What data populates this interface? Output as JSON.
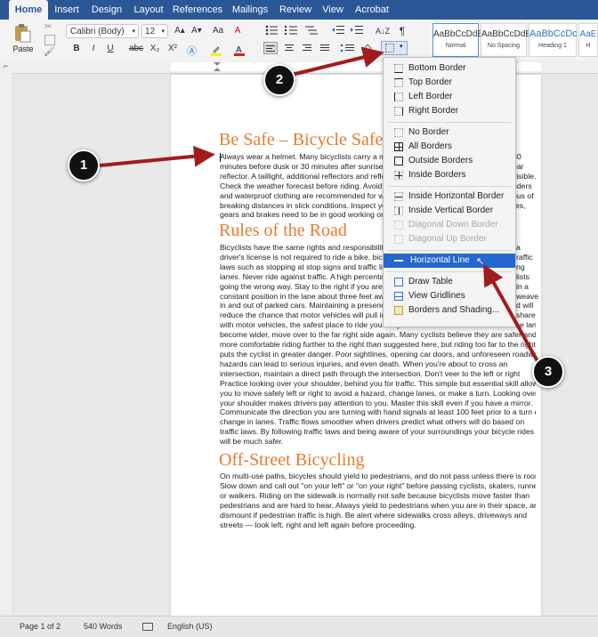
{
  "tabs": [
    "Home",
    "Insert",
    "Design",
    "Layout",
    "References",
    "Mailings",
    "Review",
    "View",
    "Acrobat"
  ],
  "ribbon": {
    "paste_label": "Paste",
    "font_name": "Calibri (Body)",
    "font_size": "12",
    "grow_font": "A▴",
    "shrink_font": "A▾",
    "change_case": "Aa",
    "clear_format": "A",
    "bold": "B",
    "italic": "I",
    "underline": "U",
    "strike": "abc",
    "subscript": "X₂",
    "superscript": "X²",
    "pilcrow": "¶",
    "sort": "A↓Z",
    "styles": [
      {
        "sample": "AaBbCcDdEe",
        "name": "Normal"
      },
      {
        "sample": "AaBbCcDdEe",
        "name": "No Spacing"
      },
      {
        "sample": "AaBbCcDc",
        "name": "Heading 1"
      },
      {
        "sample": "AaE",
        "name": "H"
      }
    ]
  },
  "document": {
    "h1": "Be Safe – Bicycle Safe",
    "p1": [
      "Always wear a helmet. Many bicyclists carry a mo",
      "minutes before dusk or 30 minutes after sunrise,",
      "reflector. A taillight, additional reflectors and refle",
      "Check the weather forecast before riding. Avoid ri",
      "and waterproof clothing are recommended for we",
      "breaking distances in slick conditions. Inspect you",
      "gears and brakes need to be in good working orde"
    ],
    "p1_right": [
      "30",
      "ear",
      "visible.",
      "nders",
      "ous of",
      "res,",
      ""
    ],
    "h2": "Rules of the Road",
    "p2": [
      "Bicyclists have the same rights and responsibilities",
      "driver's license is not required to ride a bike, bicyc",
      "laws such as stopping at stop signs and traffic ligh",
      "lanes. Never ride against traffic. A high percentag",
      "going the wrong way. Stay to the right if you are n",
      "constant position in the lane about three feet awa",
      "in and out of parked cars. Maintaining a presence",
      "reduce the chance that motor vehicles will pull in",
      "with motor vehicles, the safest place to ride your bicycle is in the middle of the lane. If the lanes",
      "become wider, move over to the far right side again. Many cyclists believe they are safer and",
      "more comfortable riding further to the right than suggested here, but riding too far to the right",
      "puts the cyclist in greater danger. Poor sightlines, opening car doors, and unforeseen roadway",
      "hazards can lead to serious injuries, and even death. When you're about to cross an",
      "intersection, maintain a direct path through the intersection. Don't veer to the left or right",
      "Practice looking over your shoulder, behind you for traffic. This simple but essential skill allows",
      "you to move safely left or right to avoid a hazard, change lanes, or make a turn. Looking over",
      "your shoulder makes drivers pay attention to you. Master this skill even if you have a mirror.",
      "Communicate the direction you are turning with hand signals at least 100 feet prior to a turn or",
      "change in lanes. Traffic flows smoother when drivers predict what others will do based on",
      "traffic laws. By following traffic laws and being aware of your surroundings your bicycle rides",
      "will be much safer."
    ],
    "p2_right": [
      "a",
      "raffic",
      "ng",
      "lists",
      "in a",
      "weave",
      "d will",
      "share"
    ],
    "h3": "Off-Street Bicycling",
    "p3": [
      "On multi-use paths, bicycles should yield to pedestrians, and do not pass unless there is room.",
      "Slow down and call out \"on your left\" or \"on your right\" before passing cyclists, skaters, runners",
      "or walkers. Riding on the sidewalk is normally not safe because bicyclists move faster than",
      "pedestrians and are hard to hear. Always yield to pedestrians when you are in their space, and",
      "dismount if pedestrian traffic is high. Be alert where sidewalks cross alleys, driveways and",
      "streets — look left, right and left again before proceeding."
    ]
  },
  "menu": [
    {
      "label": "Bottom Border",
      "disabled": false
    },
    {
      "label": "Top Border",
      "disabled": false
    },
    {
      "label": "Left Border",
      "disabled": false
    },
    {
      "label": "Right Border",
      "disabled": false
    },
    {
      "label": "No Border",
      "disabled": false
    },
    {
      "label": "All Borders",
      "disabled": false
    },
    {
      "label": "Outside Borders",
      "disabled": false
    },
    {
      "label": "Inside Borders",
      "disabled": false
    },
    {
      "label": "Inside Horizontal Border",
      "disabled": false
    },
    {
      "label": "Inside Vertical Border",
      "disabled": false
    },
    {
      "label": "Diagonal Down Border",
      "disabled": true
    },
    {
      "label": "Diagonal Up Border",
      "disabled": true
    },
    {
      "label": "Horizontal Line",
      "disabled": false,
      "highlighted": true
    },
    {
      "label": "Draw Table",
      "disabled": false
    },
    {
      "label": "View Gridlines",
      "disabled": false
    },
    {
      "label": "Borders and Shading...",
      "disabled": false
    }
  ],
  "status": {
    "page": "Page 1 of 2",
    "words": "540 Words",
    "language": "English (US)"
  },
  "callouts": [
    "1",
    "2",
    "3"
  ],
  "colors": {
    "tab_bar": "#2b5797",
    "heading": "#e97a2c",
    "menu_highlight": "#2467d0",
    "arrow": "#a11d1d"
  }
}
